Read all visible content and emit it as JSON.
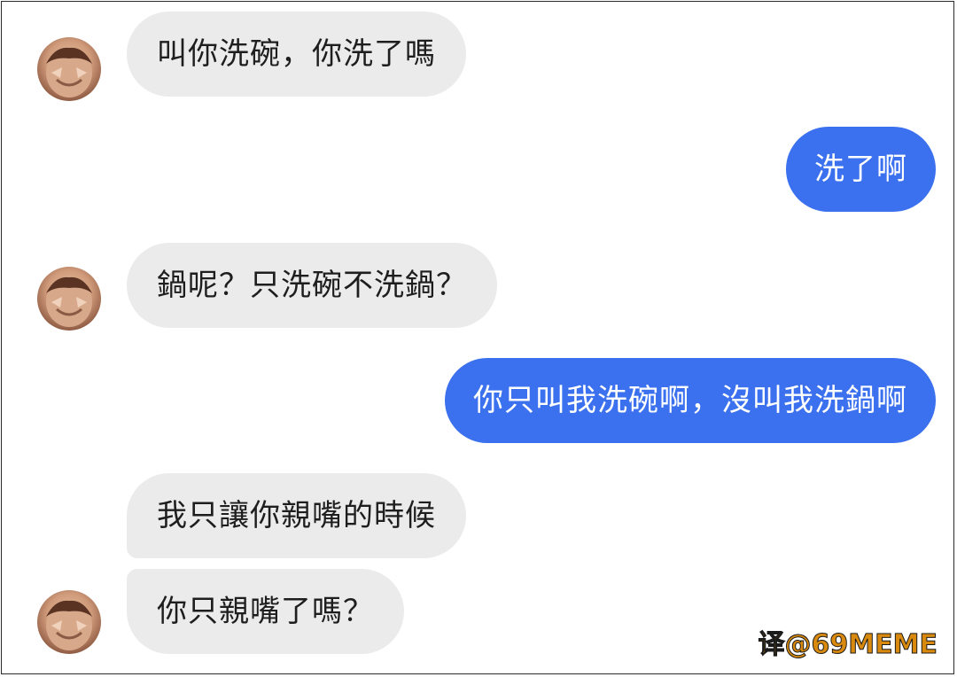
{
  "conversation": {
    "messages": [
      {
        "side": "received",
        "text": "叫你洗碗，你洗了嗎"
      },
      {
        "side": "sent",
        "text": "洗了啊"
      },
      {
        "side": "received",
        "text": "鍋呢？只洗碗不洗鍋？"
      },
      {
        "side": "sent",
        "text": "你只叫我洗碗啊，沒叫我洗鍋啊"
      },
      {
        "side": "received",
        "text": "我只讓你親嘴的時候"
      },
      {
        "side": "received",
        "text": "你只親嘴了嗎？"
      }
    ]
  },
  "watermark": {
    "text": "译@69MEME"
  },
  "colors": {
    "sent_bubble": "#3b70ee",
    "received_bubble": "#ebebeb",
    "watermark": "#d98a0e"
  }
}
